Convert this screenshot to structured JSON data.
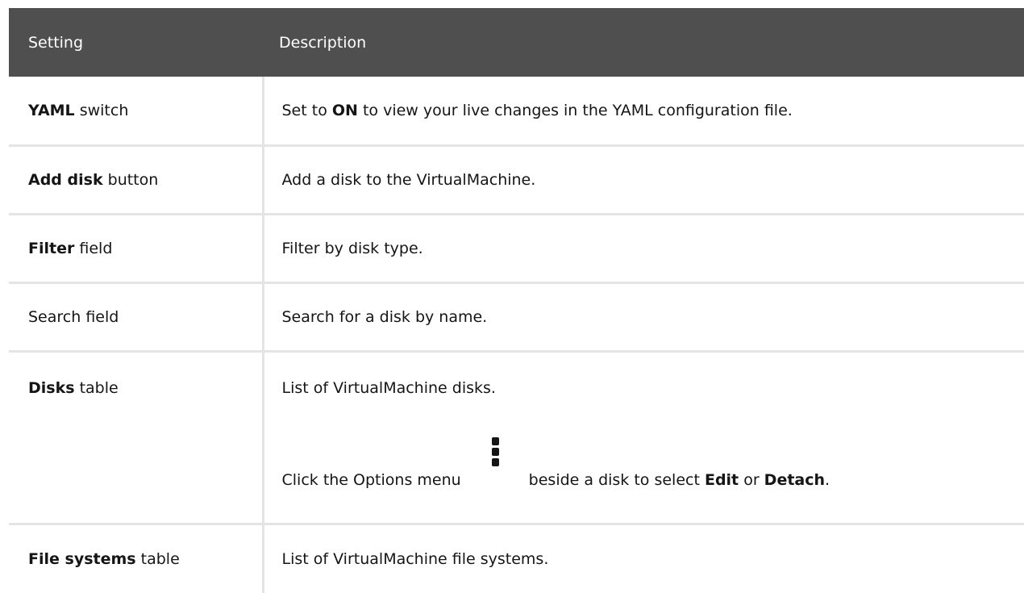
{
  "header": {
    "setting": "Setting",
    "description": "Description"
  },
  "rows": [
    {
      "setting_bold": "YAML",
      "setting_rest": " switch",
      "desc_pre": "Set to ",
      "desc_bold": "ON",
      "desc_post": " to view your live changes in the YAML configuration file."
    },
    {
      "setting_bold": "Add disk",
      "setting_rest": " button",
      "desc": "Add a disk to the VirtualMachine."
    },
    {
      "setting_bold": "Filter",
      "setting_rest": " field",
      "desc": "Filter by disk type."
    },
    {
      "setting": "Search field",
      "desc": "Search for a disk by name."
    },
    {
      "setting_bold": "Disks",
      "setting_rest": " table",
      "desc": "List of VirtualMachine disks.",
      "note_pre": "Click the Options menu",
      "note_icon": "kebab-icon",
      "note_mid": "beside a disk to select ",
      "note_bold1": "Edit",
      "note_or": " or ",
      "note_bold2": "Detach",
      "note_end": "."
    },
    {
      "setting_bold": "File systems",
      "setting_rest": " table",
      "desc": "List of VirtualMachine file systems."
    }
  ]
}
